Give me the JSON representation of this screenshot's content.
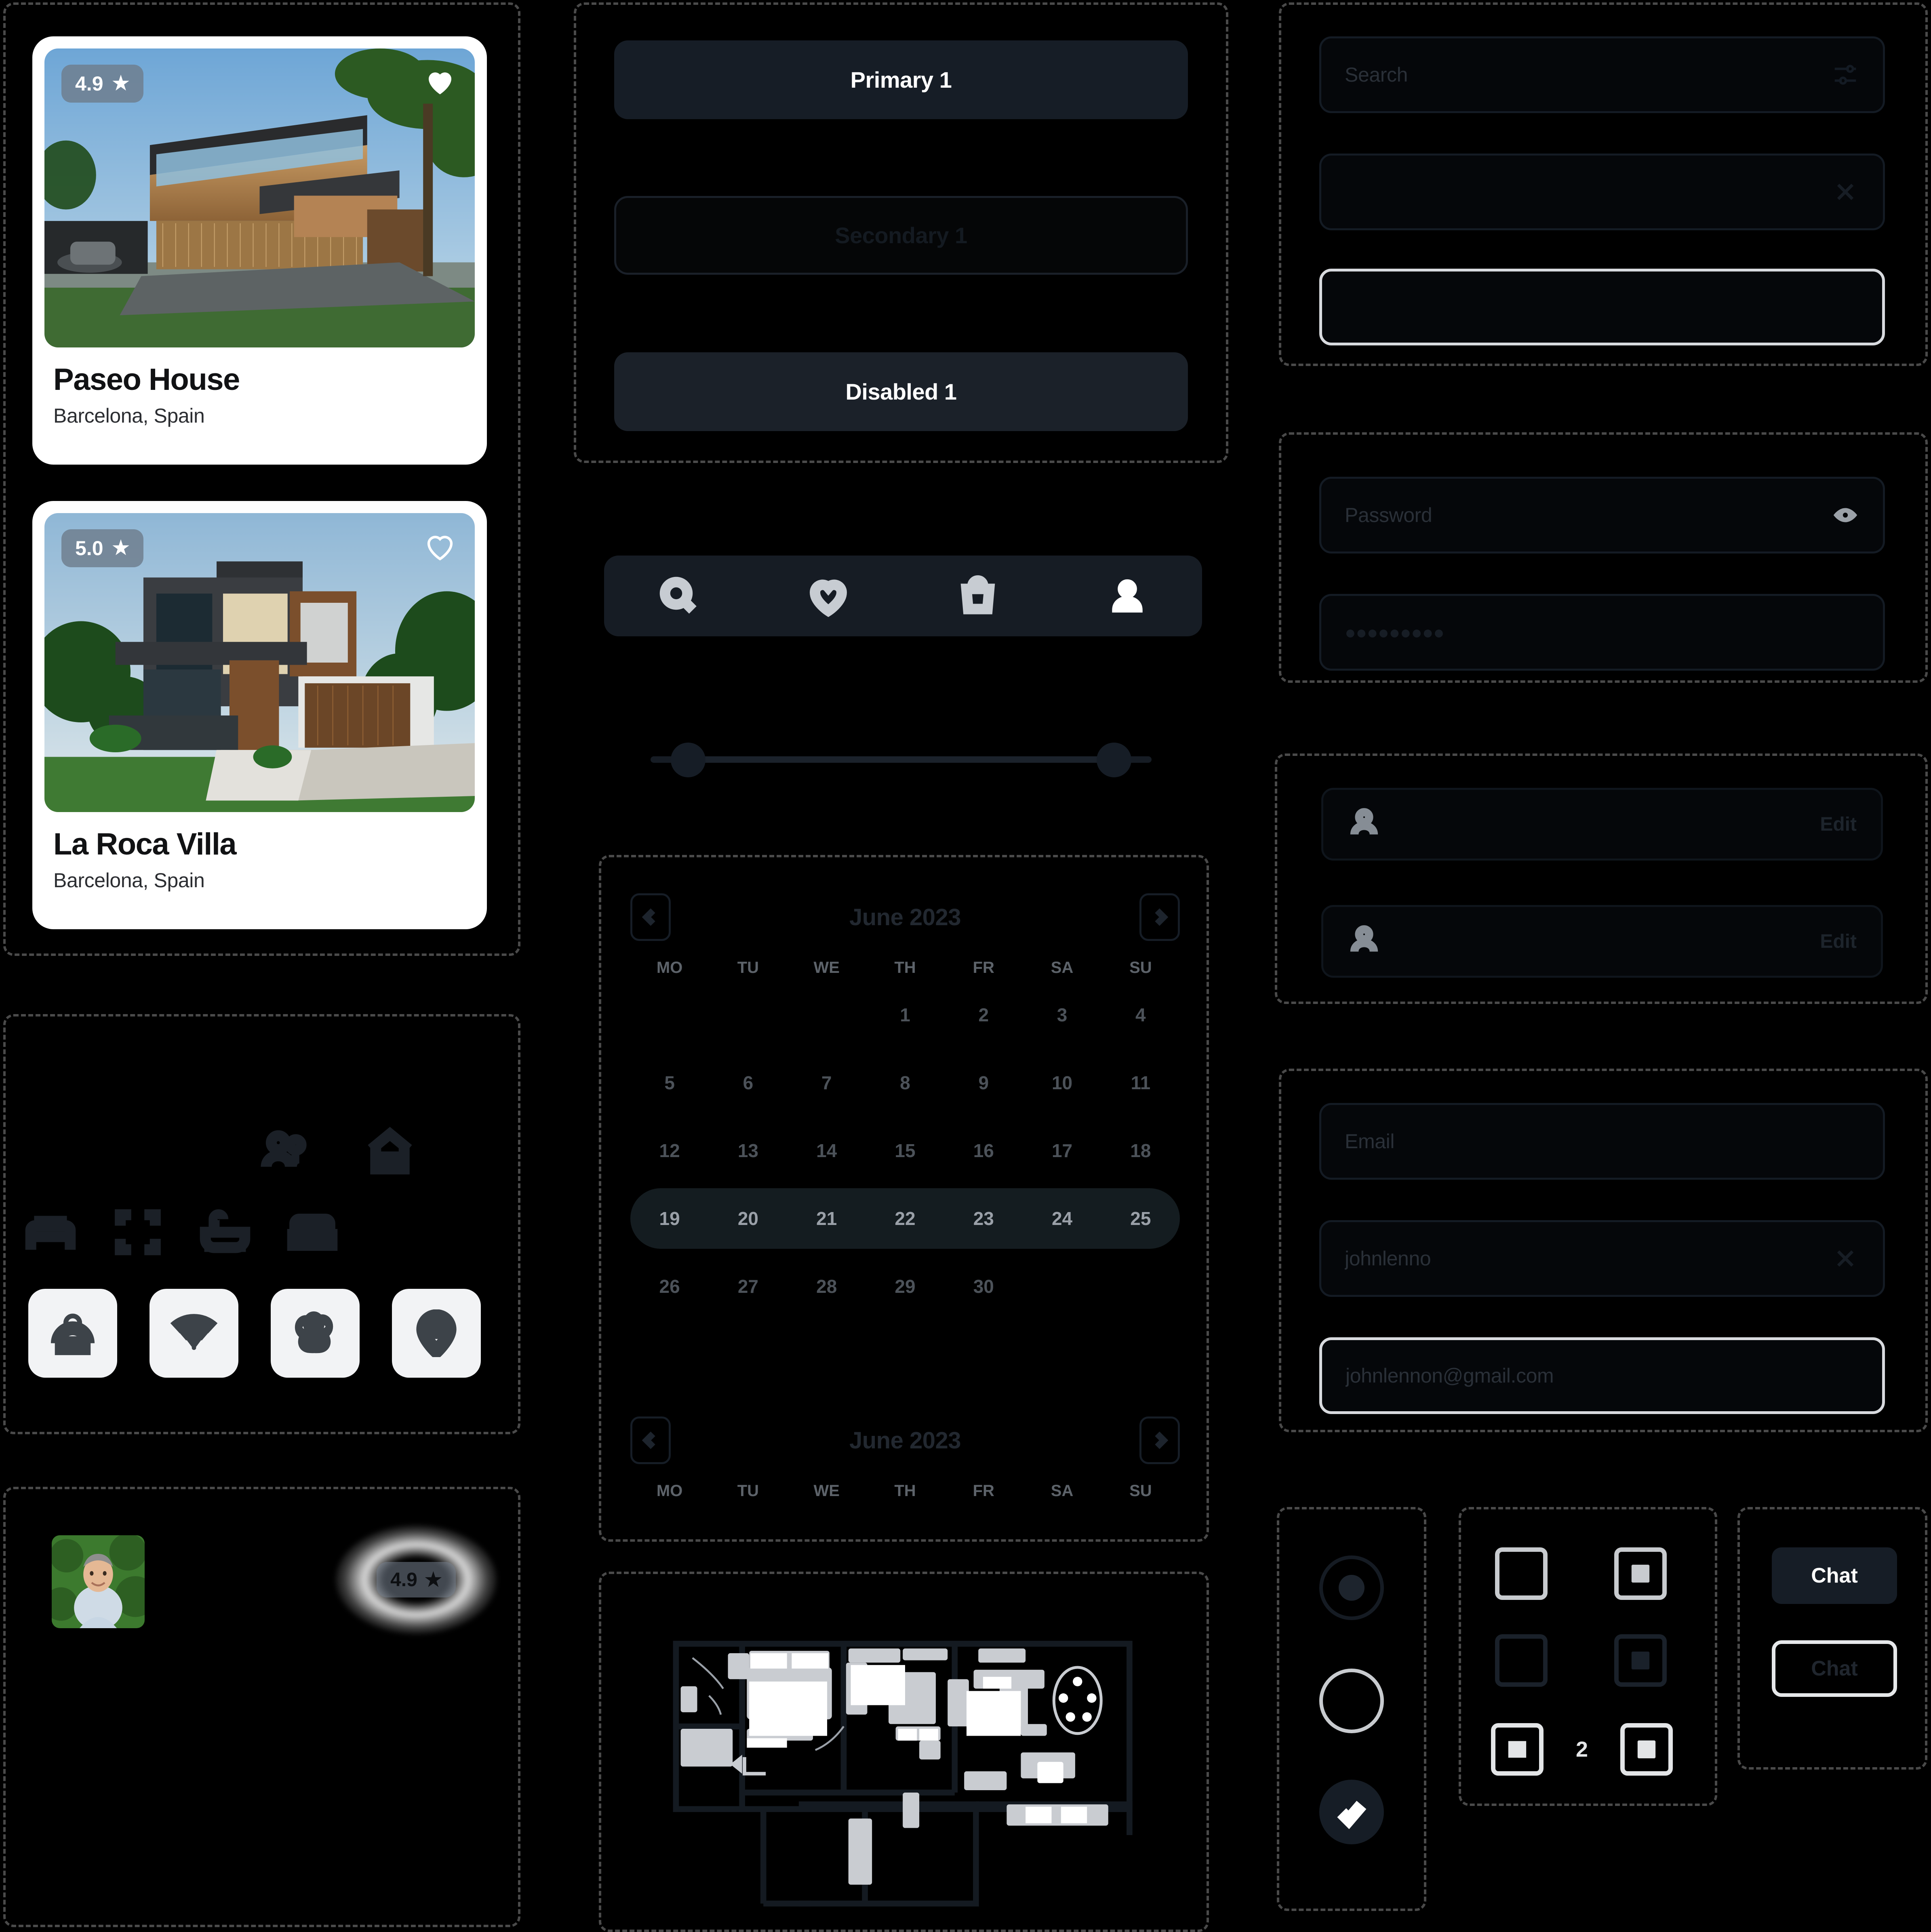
{
  "cards": {
    "items": [
      {
        "rating": "4.9",
        "star": "★",
        "title": "Paseo House",
        "location": "Barcelona, Spain",
        "favorited": true
      },
      {
        "rating": "5.0",
        "star": "★",
        "title": "La Roca Villa",
        "location": "Barcelona, Spain",
        "favorited": false
      }
    ]
  },
  "buttons": {
    "primary": "Primary 1",
    "secondary": "Secondary 1",
    "disabled": "Disabled 1"
  },
  "tabbar": {
    "items": [
      {
        "icon": "search-icon",
        "active": false
      },
      {
        "icon": "heart-icon",
        "active": false
      },
      {
        "icon": "bag-icon",
        "active": false
      },
      {
        "icon": "person-icon",
        "active": true
      }
    ]
  },
  "slider": {
    "min_percent": 6,
    "max_percent": 94
  },
  "calendar": {
    "top": {
      "title": "June 2023",
      "dow": [
        "MO",
        "TU",
        "WE",
        "TH",
        "FR",
        "SA",
        "SU"
      ],
      "lead_blanks": 3,
      "days": [
        1,
        2,
        3,
        4,
        5,
        6,
        7,
        8,
        9,
        10,
        11,
        12,
        13,
        14,
        15,
        16,
        17,
        18,
        19,
        20,
        21,
        22,
        23,
        24,
        25,
        26,
        27,
        28,
        29,
        30
      ],
      "range_start": 19,
      "range_end": 25
    },
    "bottom": {
      "title": "June 2023",
      "dow": [
        "MO",
        "TU",
        "WE",
        "TH",
        "FR",
        "SA",
        "SU"
      ]
    }
  },
  "amenities": {
    "dark_row_a": [
      "guests-icon",
      "home-icon"
    ],
    "dark_row_b": [
      "bed-icon",
      "area-expand-icon",
      "bathtub-icon",
      "sofa-icon"
    ],
    "tiles": [
      "room-service-icon",
      "wifi-icon",
      "pets-paw-icon",
      "parking-pin-icon"
    ]
  },
  "host": {
    "avatar": "host-avatar-photo",
    "badge_rating": "4.9",
    "badge_star": "★"
  },
  "search_group": {
    "search": {
      "placeholder": "Search",
      "value": "",
      "trailing_icon": "filter-sliders-icon"
    },
    "clearable": {
      "placeholder": "",
      "value": "",
      "trailing_icon": "close-x-icon"
    },
    "focused": {
      "placeholder": "",
      "value": ""
    }
  },
  "password_group": {
    "password": {
      "placeholder": "Password",
      "value": "",
      "trailing_icon": "eye-icon"
    },
    "masked": {
      "value": "●●●●●●●●●"
    }
  },
  "rows": {
    "items": [
      {
        "icon": "person-icon",
        "action": "Edit"
      },
      {
        "icon": "person-icon",
        "action": "Edit"
      }
    ]
  },
  "email_group": {
    "email": {
      "placeholder": "Email",
      "value": ""
    },
    "username": {
      "value": "johnlenno",
      "trailing_icon": "close-x-icon"
    },
    "email_value": {
      "value": "johnlennon@gmail.com"
    }
  },
  "selection": {
    "radio_selected": "radio-on",
    "radio_unselected": "radio-off",
    "checkbox_checked": "check-icon"
  },
  "boxes": {
    "checkbox_light": "",
    "plus_light": "plus-icon",
    "checkbox_dark": "",
    "plus_dark": "plus-icon"
  },
  "stepper": {
    "minus": "minus-icon",
    "value": "2",
    "plus": "plus-icon"
  },
  "chat": {
    "solid_label": "Chat",
    "outline_label": "Chat"
  },
  "colors": {
    "background": "#000000",
    "surface": "#161d26",
    "card": "#ffffff",
    "accent_highlight": "#141c20",
    "text_light": "#ffffff",
    "text_muted": "#5d636a"
  }
}
